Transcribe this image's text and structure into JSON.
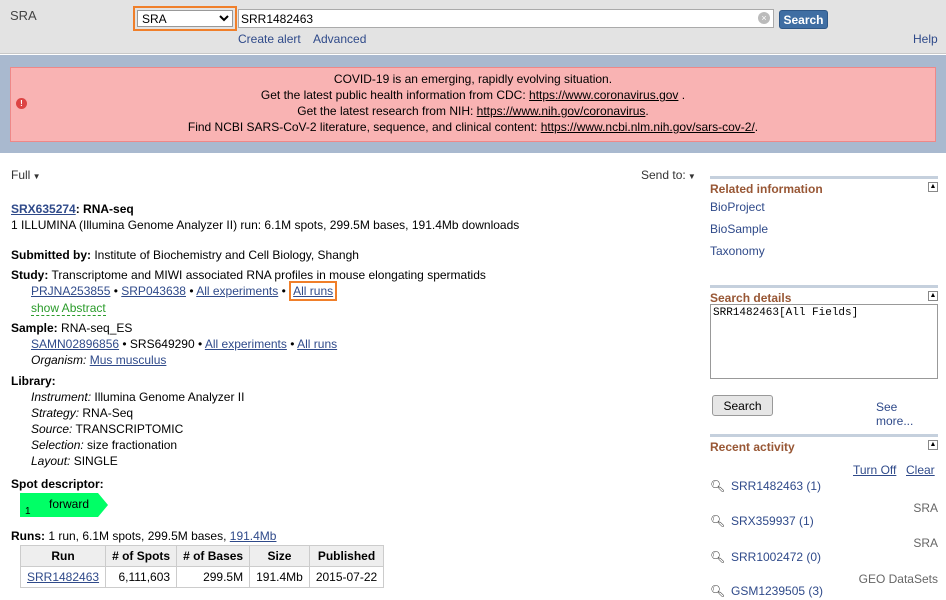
{
  "header": {
    "app_title": "SRA",
    "db_selected": "SRA",
    "search_term": "SRR1482463",
    "search_label": "Search",
    "create_alert": "Create alert",
    "advanced": "Advanced",
    "help": "Help"
  },
  "covid": {
    "line1": "COVID-19 is an emerging, rapidly evolving situation.",
    "line2_pre": "Get the latest public health information from CDC: ",
    "line2_link": "https://www.coronavirus.gov",
    "line2_post": " .",
    "line3_pre": "Get the latest research from NIH: ",
    "line3_link": "https://www.nih.gov/coronavirus",
    "line3_post": ".",
    "line4_pre": "Find NCBI SARS-CoV-2 literature, sequence, and clinical content: ",
    "line4_link": "https://www.ncbi.nlm.nih.gov/sars-cov-2/",
    "line4_post": "."
  },
  "record": {
    "format": "Full",
    "send_to": "Send to:",
    "accession": "SRX635274",
    "type": ": RNA-seq",
    "summary": "1 ILLUMINA (Illumina Genome Analyzer II) run: 6.1M spots, 299.5M bases, 191.4Mb downloads",
    "submitted_label": "Submitted by:",
    "submitted_value": " Institute of Biochemistry and Cell Biology, Shangh",
    "study_label": "Study:",
    "study_value": " Transcriptome and MIWI associated RNA profiles in mouse elongating spermatids",
    "study_links": [
      "PRJNA253855",
      "SRP043638",
      "All experiments",
      "All runs"
    ],
    "show_abstract": "show Abstract",
    "sample_label": "Sample:",
    "sample_value": " RNA-seq_ES",
    "sample_link1": "SAMN02896856",
    "sample_text": " • SRS649290 • ",
    "sample_link2": "All experiments",
    "sample_link3": "All runs",
    "organism_label": "Organism:",
    "organism_value": "Mus musculus",
    "library_label": "Library:",
    "library": [
      {
        "label": "Instrument:",
        "value": " Illumina Genome Analyzer II"
      },
      {
        "label": "Strategy:",
        "value": " RNA-Seq"
      },
      {
        "label": "Source:",
        "value": " TRANSCRIPTOMIC"
      },
      {
        "label": "Selection:",
        "value": " size fractionation"
      },
      {
        "label": "Layout:",
        "value": " SINGLE"
      }
    ],
    "spot_label": "Spot descriptor:",
    "spot_num": "1",
    "spot_name": "forward",
    "runs_label": "Runs:",
    "runs_summary": " 1 run, 6.1M spots, 299.5M bases, ",
    "runs_download": "191.4Mb",
    "runs_table": {
      "headers": [
        "Run",
        "# of Spots",
        "# of Bases",
        "Size",
        "Published"
      ],
      "rows": [
        [
          "SRR1482463",
          "6,111,603",
          "299.5M",
          "191.4Mb",
          "2015-07-22"
        ]
      ]
    }
  },
  "sidebar": {
    "related_title": "Related information",
    "related_links": [
      "BioProject",
      "BioSample",
      "Taxonomy"
    ],
    "search_details_title": "Search details",
    "search_details_query": "SRR1482463[All Fields]",
    "search_btn": "Search",
    "see_more": "See more...",
    "recent_title": "Recent activity",
    "turn_off": "Turn Off",
    "clear": "Clear",
    "recent": [
      {
        "term": "SRR1482463 (1)",
        "db": "SRA"
      },
      {
        "term": "SRX359937 (1)",
        "db": "SRA"
      },
      {
        "term": "SRR1002472 (0)",
        "db": "GEO DataSets"
      },
      {
        "term": "GSM1239505 (3)",
        "db": ""
      }
    ]
  },
  "colors": {
    "highlight": "#f07f2a",
    "accent": "#3f6ea3",
    "spot": "#00ff66"
  }
}
